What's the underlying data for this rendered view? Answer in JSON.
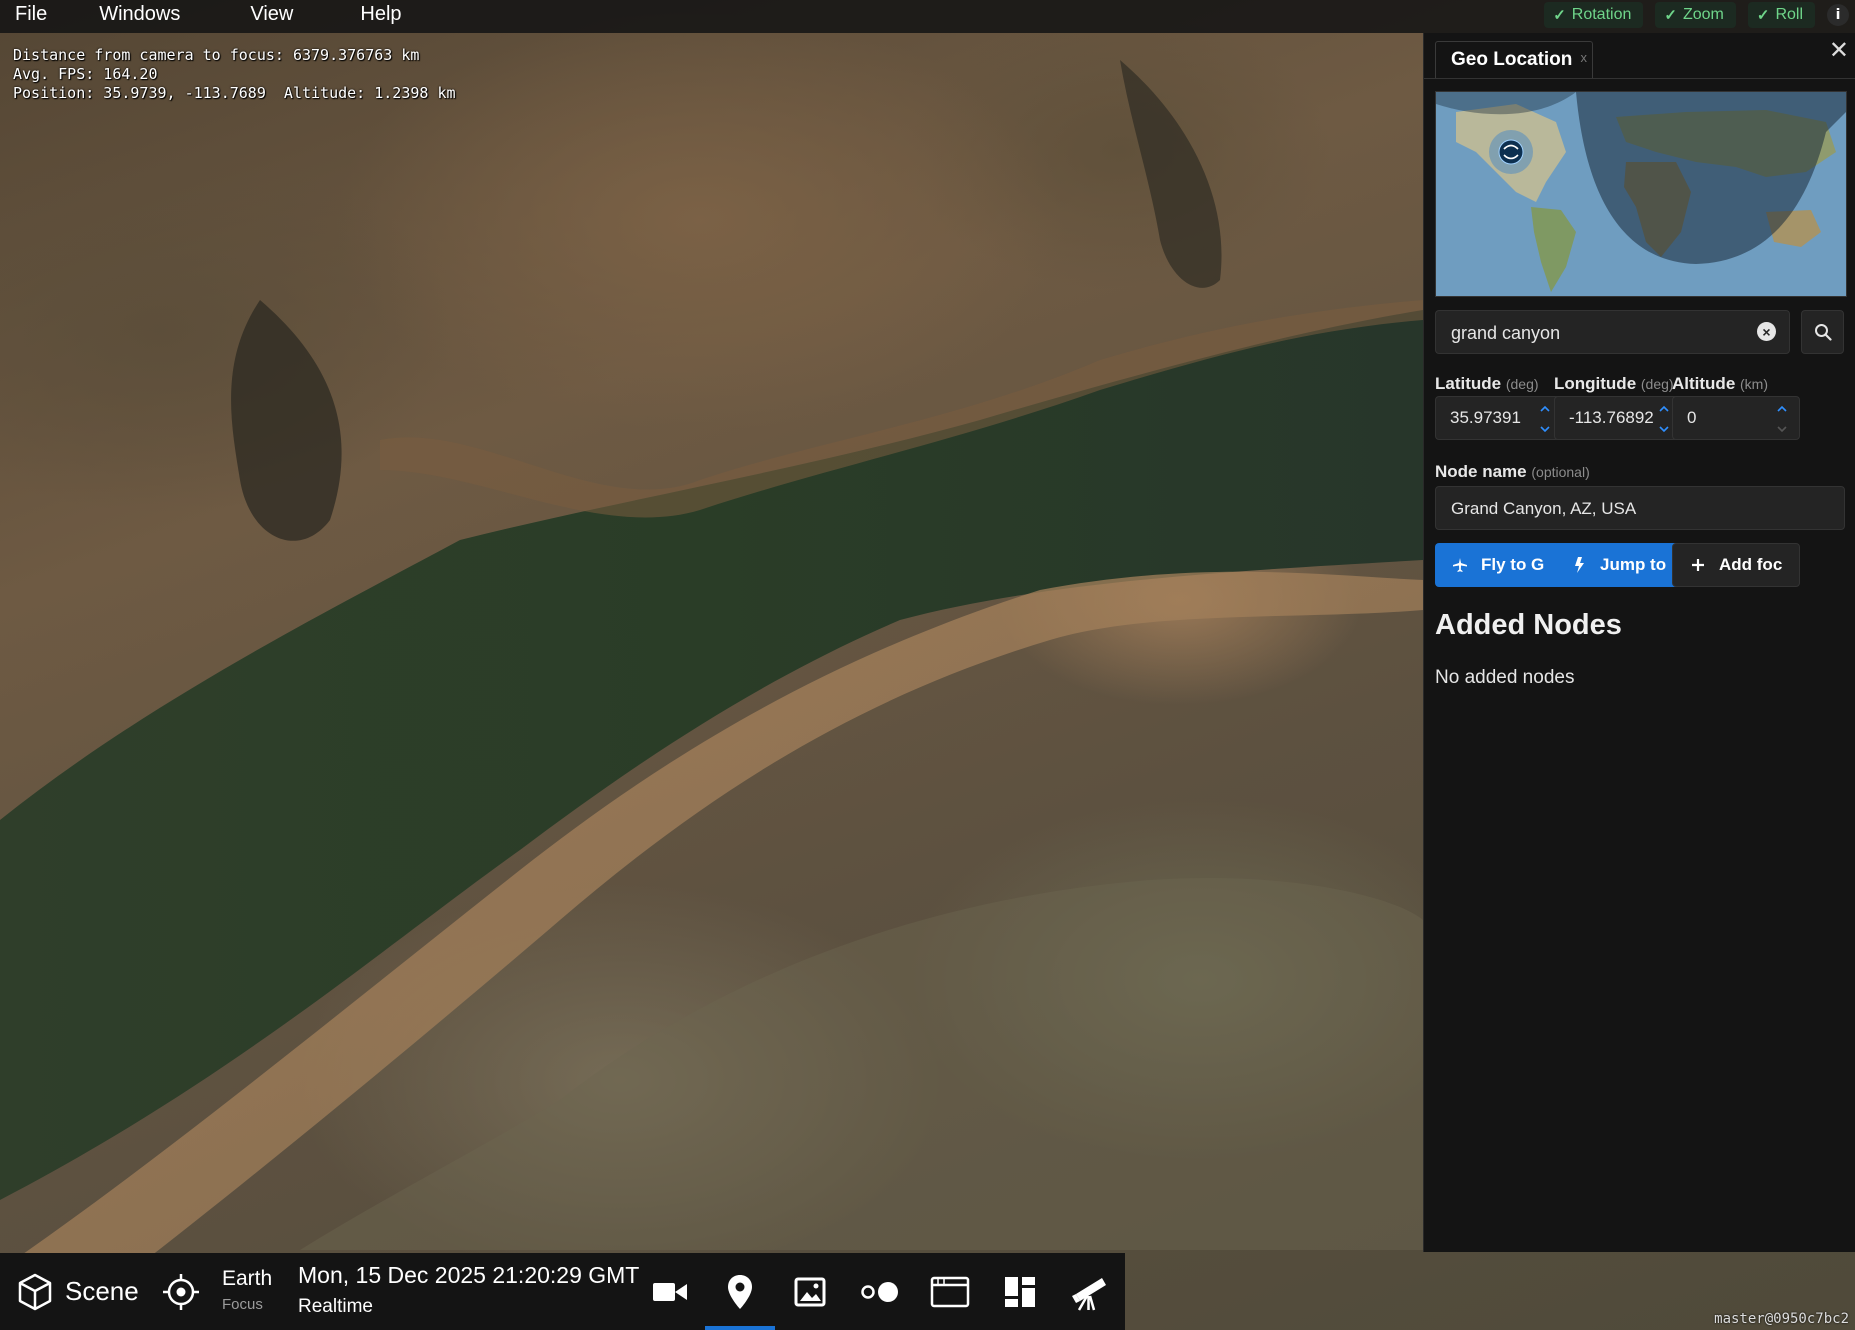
{
  "menu": {
    "items": [
      "File",
      "Windows",
      "View",
      "Help"
    ]
  },
  "toggles": [
    {
      "label": "Rotation",
      "checked": true
    },
    {
      "label": "Zoom",
      "checked": true
    },
    {
      "label": "Roll",
      "checked": true
    }
  ],
  "info_button": "i",
  "hud": {
    "line1": "Distance from camera to focus: 6379.376763 km",
    "line2": "Avg. FPS: 164.20",
    "line3": "Position: 35.9739, -113.7689  Altitude: 1.2398 km"
  },
  "panel": {
    "tab_title": "Geo Location",
    "tab_close": "x",
    "search": {
      "value": "grand canyon"
    },
    "latitude": {
      "label": "Latitude",
      "unit": "(deg)",
      "value": "35.97391"
    },
    "longitude": {
      "label": "Longitude",
      "unit": "(deg)",
      "value": "-113.76892"
    },
    "altitude": {
      "label": "Altitude",
      "unit": "(km)",
      "value": "0"
    },
    "node_name": {
      "label": "Node name",
      "hint": "(optional)",
      "value": "Grand Canyon, AZ, USA"
    },
    "buttons": {
      "fly": "Fly to G",
      "jump": "Jump to",
      "add": "Add foc"
    },
    "added_nodes_title": "Added Nodes",
    "added_nodes_empty": "No added nodes"
  },
  "bottombar": {
    "scene_label": "Scene",
    "focus_name": "Earth",
    "focus_sub": "Focus",
    "datetime": "Mon, 15 Dec 2025 21:20:29 GMT",
    "time_mode": "Realtime",
    "active_tab": "geo-location"
  },
  "colors": {
    "accent": "#1a73d6",
    "toggle_green": "#6fd58a",
    "panel_bg": "#141414"
  },
  "version": "master@0950c7bc2"
}
